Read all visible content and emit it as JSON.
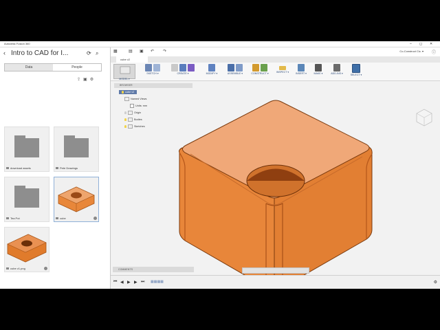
{
  "window": {
    "title": "Autodesk Fusion 360",
    "controls": [
      "–",
      "◻",
      "✕"
    ]
  },
  "data_panel": {
    "project_title": "Intro to CAD for I...",
    "tabs": [
      {
        "label": "Data",
        "active": true
      },
      {
        "label": "People",
        "active": false
      }
    ],
    "items": [
      {
        "label": "download assets",
        "type": "folder"
      },
      {
        "label": "Pete Drawings",
        "type": "folder"
      },
      {
        "label": "Tea Pot",
        "type": "folder"
      },
      {
        "label": "cube",
        "type": "design",
        "selected": true
      },
      {
        "label": "cube v1.png",
        "type": "image"
      }
    ]
  },
  "toolbar": {
    "co_construct": "Co-Construct Cic. ▾",
    "doc_tab": "cube v2",
    "ribbon": [
      {
        "label": "MODEL ▾"
      },
      {
        "label": "SKETCH ▾"
      },
      {
        "label": "CREATE ▾"
      },
      {
        "label": "MODIFY ▾"
      },
      {
        "label": "ASSEMBLE ▾"
      },
      {
        "label": "CONSTRUCT ▾"
      },
      {
        "label": "INSPECT ▾"
      },
      {
        "label": "INSERT ▾"
      },
      {
        "label": "MAKE ▾"
      },
      {
        "label": "ADD-INS ▾"
      },
      {
        "label": "SELECT ▾"
      }
    ]
  },
  "browser": {
    "header": "BROWSER",
    "root": "cube v2",
    "children": [
      "Named Views",
      "Units: mm",
      "Origin",
      "Bodies",
      "Sketches"
    ]
  },
  "comments": {
    "label": "COMMENTS"
  },
  "colors": {
    "model_orange": "#e8873a",
    "model_top": "#eea56d",
    "accent_blue": "#2d4b7a"
  }
}
